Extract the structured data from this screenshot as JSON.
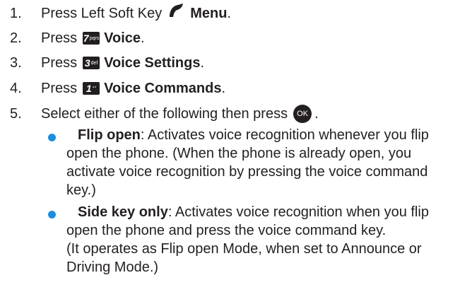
{
  "steps": [
    {
      "num": "1.",
      "pre": "Press Left Soft Key",
      "bold": "Menu",
      "post": ".",
      "icon": "left-soft-key-icon"
    },
    {
      "num": "2.",
      "pre": "Press",
      "key_digit": "7",
      "key_letters": "pqrs",
      "bold": "Voice",
      "post": "."
    },
    {
      "num": "3.",
      "pre": "Press",
      "key_digit": "3",
      "key_letters": "def",
      "bold": "Voice Settings",
      "post": "."
    },
    {
      "num": "4.",
      "pre": "Press",
      "key_digit": "1",
      "key_letters": "°°",
      "bold": "Voice Commands",
      "post": "."
    },
    {
      "num": "5.",
      "pre": "Select either of the following then press",
      "ok_label": "OK",
      "post": "."
    }
  ],
  "options": [
    {
      "term": "Flip open",
      "lines": [
        ": Activates voice recognition whenever you flip",
        "open the phone. (When the phone is already open, you",
        "activate voice recognition by pressing the voice command",
        "key.)"
      ]
    },
    {
      "term": "Side key only",
      "lines": [
        ": Activates voice recognition when you flip",
        "open the phone and press the voice command key.",
        "(It operates as Flip open Mode, when set to Announce or",
        "Driving Mode.)"
      ]
    }
  ],
  "colors": {
    "text": "#231f20",
    "bullet": "#1a8fe0"
  }
}
